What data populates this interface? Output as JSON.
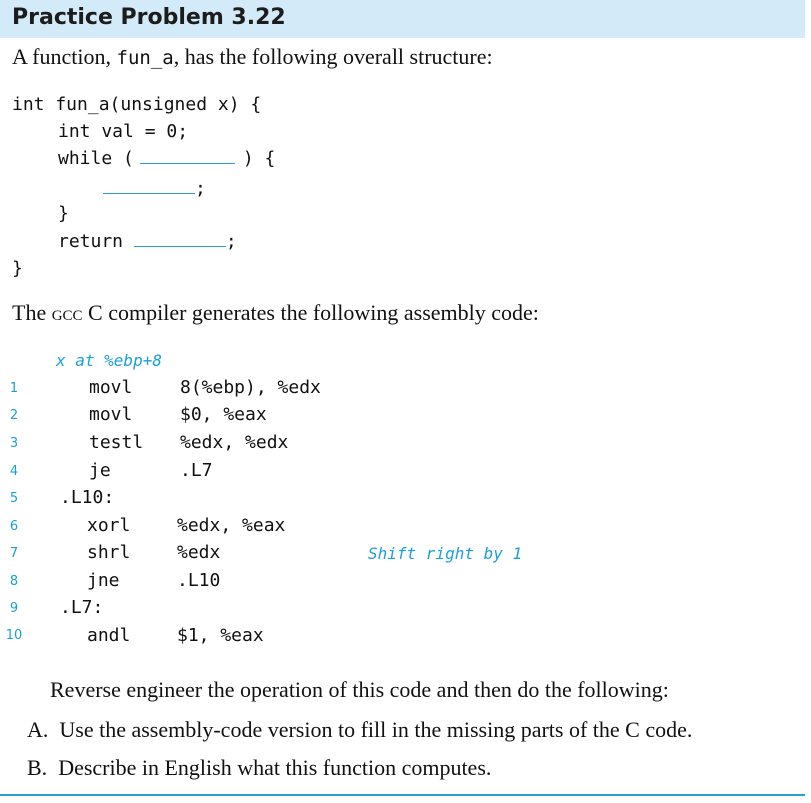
{
  "title": "Practice Problem 3.22",
  "intro": {
    "prefix": "A function, ",
    "fname": "fun_a",
    "suffix": ", has the following overall structure:"
  },
  "c_code": {
    "line1": "int fun_a(unsigned x) {",
    "line2": "int val = 0;",
    "line3_a": "while (",
    "line3_b": ") {",
    "line4_end": ";",
    "line5": "}",
    "line6": "return",
    "line6_end": ";",
    "line7": "}"
  },
  "gcc_text": {
    "prefix": "The ",
    "gcc": "gcc",
    "suffix": " C compiler generates the following assembly code:"
  },
  "asm_header": "x at %ebp+8",
  "asm_lines": [
    {
      "num": "1",
      "op": "movl",
      "args": "8(%ebp), %edx",
      "comment": ""
    },
    {
      "num": "2",
      "op": "movl",
      "args": "$0, %eax",
      "comment": ""
    },
    {
      "num": "3",
      "op": "testl",
      "args": "%edx, %edx",
      "comment": ""
    },
    {
      "num": "4",
      "op": "je",
      "args": ".L7",
      "comment": ""
    },
    {
      "num": "5",
      "label": ".L10:"
    },
    {
      "num": "6",
      "op": "xorl",
      "args": "%edx, %eax",
      "comment": ""
    },
    {
      "num": "7",
      "op": "shrl",
      "args": "%edx",
      "comment": "Shift right by 1"
    },
    {
      "num": "8",
      "op": "jne",
      "args": ".L10",
      "comment": ""
    },
    {
      "num": "9",
      "label": ".L7:"
    },
    {
      "num": "10",
      "op": "andl",
      "args": "$1, %eax",
      "comment": ""
    }
  ],
  "instructions": {
    "lead": "Reverse engineer the operation of this code and then do the following:",
    "items": [
      {
        "letter": "A.",
        "text": "Use the assembly-code version to fill in the missing parts of the C code."
      },
      {
        "letter": "B.",
        "text": "Describe in English what this function computes."
      }
    ]
  },
  "colors": {
    "title_bg": "#d3eaf8",
    "accent": "#1a9fd9"
  }
}
